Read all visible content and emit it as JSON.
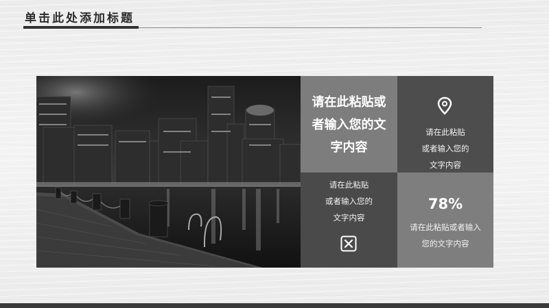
{
  "slide": {
    "title": "单击此处添加标题"
  },
  "tiles": {
    "main_text": [
      "请在此粘贴或",
      "者输入您的文",
      "字内容"
    ],
    "location_tile": {
      "icon": "location-pin-icon",
      "lines": [
        "请在此粘贴",
        "或者输入您的",
        "文字内容"
      ]
    },
    "x_tile": {
      "icon": "x-box-icon",
      "lines": [
        "请在此粘贴",
        "或者输入您的",
        "文字内容"
      ]
    },
    "percent_tile": {
      "value": "78%",
      "lines": [
        "请在此粘贴或者输入",
        "您的文字内容"
      ]
    }
  },
  "image": {
    "subject": "city-harbor-night-photo"
  },
  "colors": {
    "tile_light": "#7d7d7d",
    "tile_dark": "#4d4d4d",
    "title": "#2b2b2b",
    "footer": "#3a3a3a"
  }
}
